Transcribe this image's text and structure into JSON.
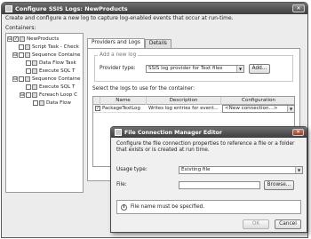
{
  "window": {
    "title": "Configure SSIS Logs: NewProducts",
    "intro": "Create and configure a new log to capture log-enabled events that occur at run-time.",
    "containers_label": "Containers:"
  },
  "tree": [
    {
      "label": "NewProducts",
      "checked": "✓",
      "expander": "⊟"
    },
    {
      "label": "Script Task - Check",
      "checked": "",
      "expander": ""
    },
    {
      "label": "Sequence Containe",
      "checked": "",
      "expander": "⊟"
    },
    {
      "label": "Data Flow Task",
      "checked": "",
      "expander": ""
    },
    {
      "label": "Execute SQL T",
      "checked": "",
      "expander": ""
    },
    {
      "label": "Sequence Containe",
      "checked": "",
      "expander": "⊟"
    },
    {
      "label": "Execute SQL T",
      "checked": "",
      "expander": ""
    },
    {
      "label": "Foreach Loop C",
      "checked": "",
      "expander": "⊟"
    },
    {
      "label": "Data Flow",
      "checked": "",
      "expander": ""
    }
  ],
  "tabs": [
    "Providers and Logs",
    "Details"
  ],
  "add_log": {
    "legend": "Add a new log",
    "provider_label": "Provider type:",
    "provider_value": "SSIS log provider for Text files",
    "add_button": "Add..."
  },
  "logs": {
    "label": "Select the logs to use for the container:",
    "columns": [
      "Name",
      "Description",
      "Configuration"
    ],
    "rows": [
      {
        "checked": "✓",
        "name": "PackageTextLog",
        "description": "Writes log entries for event...",
        "configuration": "<New connection...>"
      }
    ]
  },
  "dialog": {
    "title": "File Connection Manager Editor",
    "description": "Configure the file connection properties to reference a file or a folder that exists or is created at run time.",
    "usage_label": "Usage type:",
    "usage_value": "Existing file",
    "file_label": "File:",
    "file_value": "",
    "browse_button": "Browse...",
    "message": "File name must be specified.",
    "ok_button": "OK",
    "cancel_button": "Cancel"
  }
}
